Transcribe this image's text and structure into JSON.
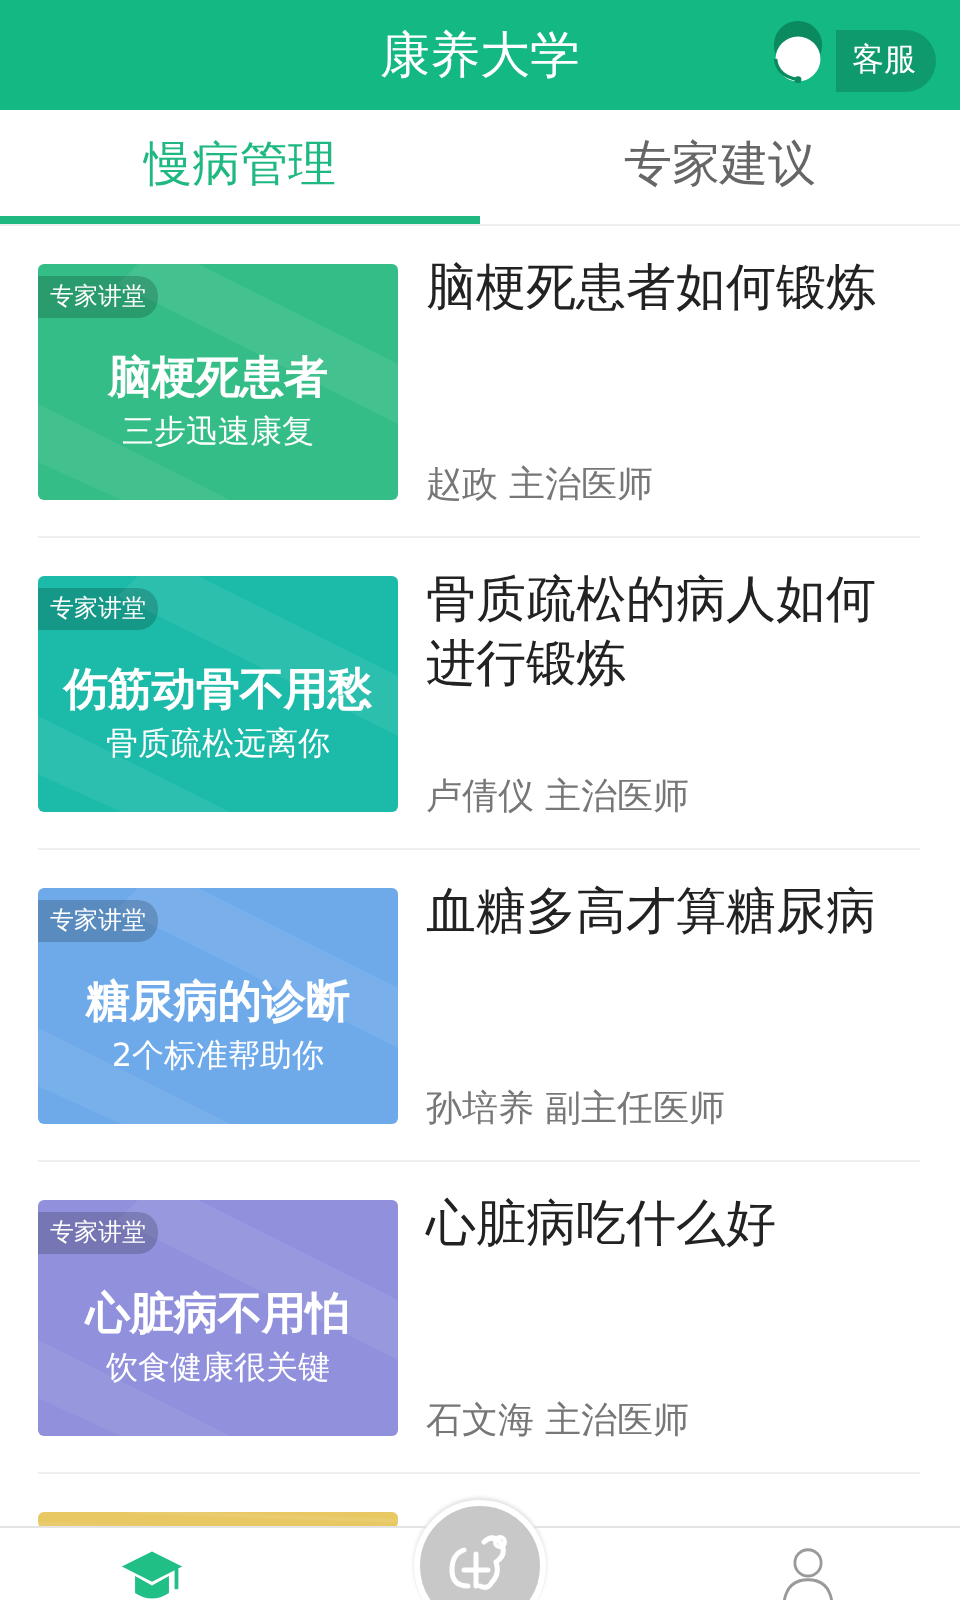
{
  "header": {
    "title": "康养大学",
    "service_button": "客服"
  },
  "tabs": [
    {
      "label": "慢病管理",
      "selected": true
    },
    {
      "label": "专家建议",
      "selected": false
    }
  ],
  "articles": [
    {
      "tag": "专家讲堂",
      "headline": "脑梗死患者",
      "subline": "三步迅速康复",
      "title": "脑梗死患者如何锻炼",
      "author": "赵政 主治医师",
      "color": "#34bd86"
    },
    {
      "tag": "专家讲堂",
      "headline": "伤筋动骨不用愁",
      "subline": "骨质疏松远离你",
      "title": "骨质疏松的病人如何进行锻炼",
      "author": "卢倩仪 主治医师",
      "color": "#1cbaa8"
    },
    {
      "tag": "专家讲堂",
      "headline": "糖尿病的诊断",
      "subline": "2个标准帮助你",
      "title": "血糖多高才算糖尿病",
      "author": "孙培养 副主任医师",
      "color": "#6eaaea"
    },
    {
      "tag": "专家讲堂",
      "headline": "心脏病不用怕",
      "subline": "饮食健康很关键",
      "title": "心脏病吃什么好",
      "author": "石文海 主治医师",
      "color": "#9090dc"
    },
    {
      "color": "#e8c862"
    }
  ],
  "bottom_nav": [
    {
      "kind": "cap",
      "selected": true
    },
    {
      "kind": "center",
      "selected": false
    },
    {
      "kind": "person",
      "selected": false
    }
  ]
}
